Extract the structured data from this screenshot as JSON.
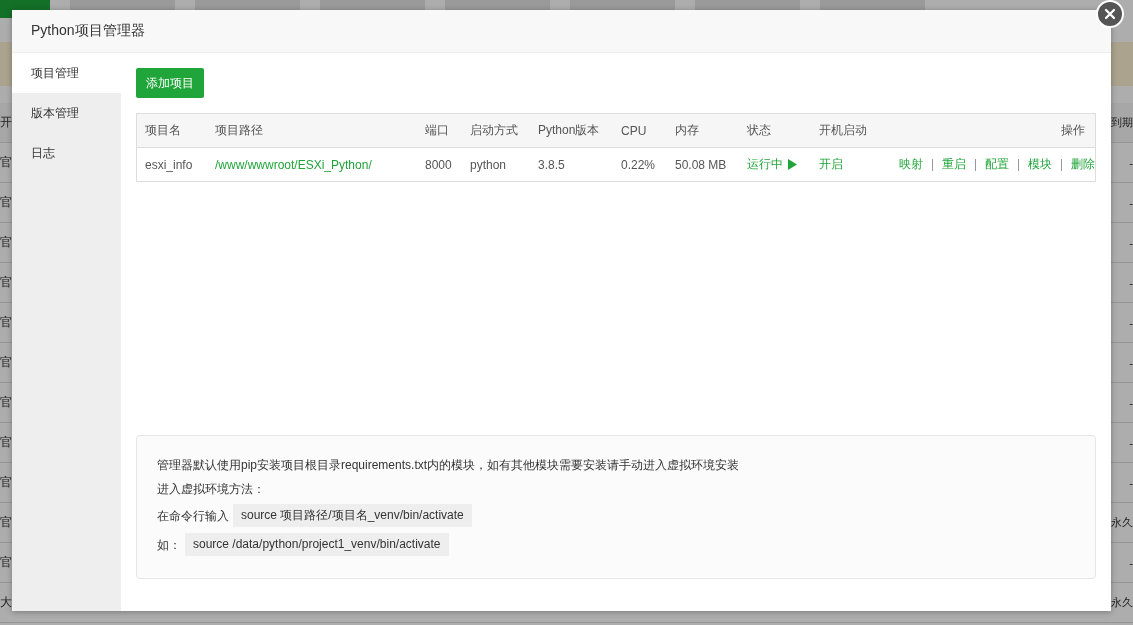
{
  "background": {
    "tabs": [
      {
        "selected": true
      },
      {
        "selected": false
      },
      {
        "selected": false
      },
      {
        "selected": false
      },
      {
        "selected": false
      },
      {
        "selected": false
      },
      {
        "selected": false
      },
      {
        "selected": false
      }
    ],
    "header_left": "开",
    "header_right": "到期",
    "rows": [
      {
        "left": "官",
        "right": "-"
      },
      {
        "left": "官",
        "right": "-"
      },
      {
        "left": "官",
        "right": "-"
      },
      {
        "left": "官",
        "right": "-"
      },
      {
        "left": "官",
        "right": "-"
      },
      {
        "left": "官",
        "right": "-"
      },
      {
        "left": "官",
        "right": "-"
      },
      {
        "left": "官",
        "right": "-"
      },
      {
        "left": "官",
        "right": "-"
      },
      {
        "left": "官",
        "right": "永久"
      },
      {
        "left": "官",
        "right": "-"
      },
      {
        "left": "大",
        "right": "永久"
      }
    ]
  },
  "dialog": {
    "title": "Python项目管理器",
    "sidebar": [
      {
        "label": "项目管理",
        "selected": true
      },
      {
        "label": "版本管理",
        "selected": false
      },
      {
        "label": "日志",
        "selected": false
      }
    ],
    "add_button": "添加项目",
    "columns": [
      "项目名",
      "项目路径",
      "端口",
      "启动方式",
      "Python版本",
      "CPU",
      "内存",
      "状态",
      "开机启动",
      "操作"
    ],
    "rows": [
      {
        "name": "esxi_info",
        "path": "/www/wwwroot/ESXi_Python/",
        "port": "8000",
        "start_mode": "python",
        "version": "3.8.5",
        "cpu": "0.22%",
        "memory": "50.08 MB",
        "status": "运行中",
        "running": true,
        "autostart": "开启",
        "autostart_on": true,
        "actions": [
          "映射",
          "重启",
          "配置",
          "模块",
          "删除"
        ]
      }
    ],
    "help": {
      "line1": "管理器默认使用pip安装项目根目录requirements.txt内的模块，如有其他模块需要安装请手动进入虚拟环境安装",
      "line2": "进入虚拟环境方法：",
      "cmd_label": "在命令行输入",
      "cmd_code": "source 项目路径/项目名_venv/bin/activate",
      "eg_label": "如：",
      "eg_code": "source /data/python/project1_venv/bin/activate"
    }
  }
}
